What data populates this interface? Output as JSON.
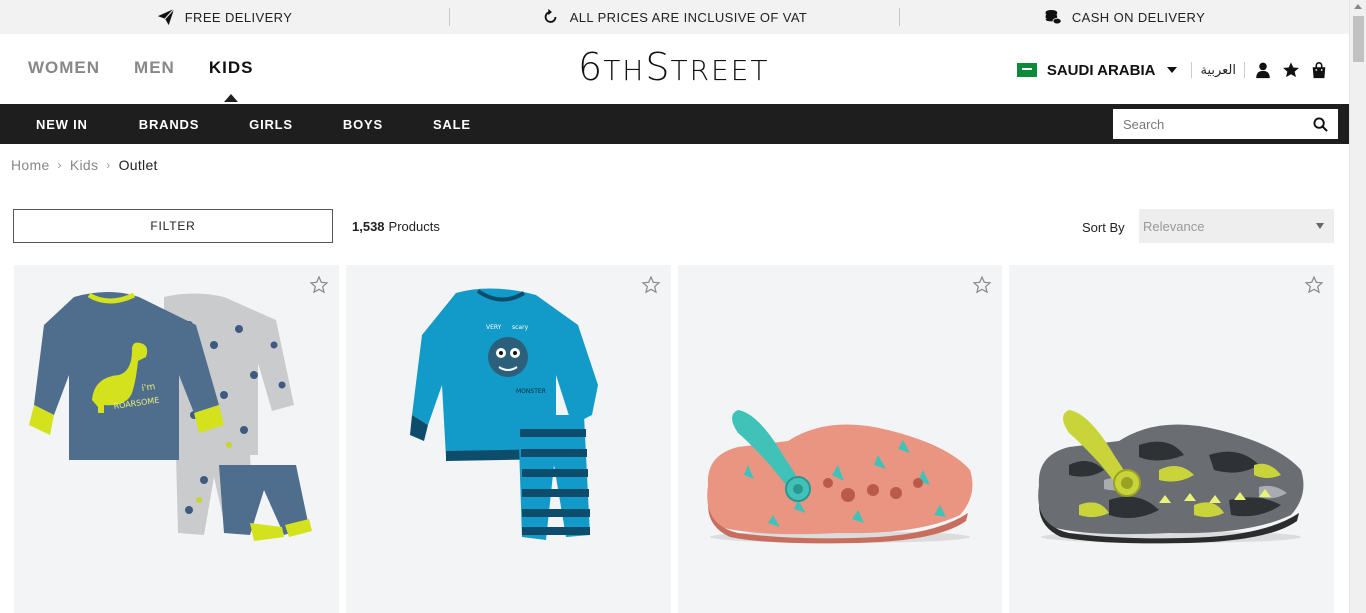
{
  "promo": {
    "items": [
      {
        "label": "FREE DELIVERY",
        "icon": "paper-plane-icon"
      },
      {
        "label": "ALL PRICES ARE INCLUSIVE OF VAT",
        "icon": "rotate-icon"
      },
      {
        "label": "CASH ON DELIVERY",
        "icon": "coins-icon"
      }
    ]
  },
  "header": {
    "gender_tabs": [
      {
        "label": "WOMEN",
        "active": false
      },
      {
        "label": "MEN",
        "active": false
      },
      {
        "label": "KIDS",
        "active": true
      }
    ],
    "logo": {
      "first": "6",
      "small": "TH",
      "rest": "S",
      "small2": "TREET"
    },
    "country": "SAUDI ARABIA",
    "language": "العربية",
    "icons": [
      "user-icon",
      "star-icon",
      "shopping-bag-icon"
    ]
  },
  "catnav": {
    "items": [
      "NEW IN",
      "BRANDS",
      "GIRLS",
      "BOYS",
      "SALE"
    ]
  },
  "search": {
    "placeholder": "Search"
  },
  "breadcrumb": [
    "Home",
    "Kids",
    "Outlet"
  ],
  "toolbar": {
    "filter_label": "FILTER",
    "count_number": "1,538",
    "count_label": "Products",
    "sort_label": "Sort By",
    "sort_value": "Relevance"
  },
  "products": [
    {
      "image": "dinosaur-pyjamas-set"
    },
    {
      "image": "monster-pyjamas-set"
    },
    {
      "image": "coral-clog-shoe"
    },
    {
      "image": "camo-clog-shoe"
    }
  ],
  "colors": {
    "nav_bg": "#1e1e1e",
    "promo_bg": "#f2f2f2",
    "card_bg": "#f3f4f5",
    "flag_green": "#0b8a3a"
  }
}
